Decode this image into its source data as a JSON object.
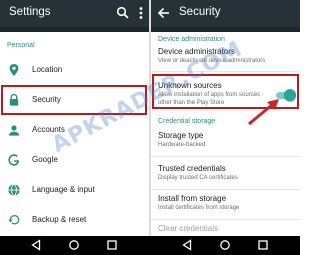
{
  "left": {
    "title": "Settings",
    "section_header": "Personal",
    "items": [
      {
        "label": "Location",
        "icon": "location-pin-icon"
      },
      {
        "label": "Security",
        "icon": "lock-icon"
      },
      {
        "label": "Accounts",
        "icon": "account-icon"
      },
      {
        "label": "Google",
        "icon": "google-icon"
      },
      {
        "label": "Language & input",
        "icon": "globe-icon"
      },
      {
        "label": "Backup & reset",
        "icon": "backup-icon"
      }
    ]
  },
  "right": {
    "title": "Security",
    "device_admin_header": "Device administration",
    "credential_header": "Credential storage",
    "prefs": {
      "device_admins": {
        "title": "Device administrators",
        "summary": "View or deactivate device administrators"
      },
      "unknown_sources": {
        "title": "Unknown sources",
        "summary": "Allow installation of apps from sources other than the Play Store",
        "enabled": true
      },
      "storage_type": {
        "title": "Storage type",
        "summary": "Hardware-backed"
      },
      "trusted_credentials": {
        "title": "Trusted credentials",
        "summary": "Display trusted CA certificates"
      },
      "install_from_storage": {
        "title": "Install from storage",
        "summary": "Install certificates from storage"
      },
      "clear_credentials": {
        "title": "Clear credentials"
      }
    }
  },
  "watermark": "APKRADER.COM",
  "colors": {
    "appbar": "#263238",
    "accent": "#26a69a",
    "highlight": "#b71c1c",
    "section_header": "#2e8b7e"
  }
}
